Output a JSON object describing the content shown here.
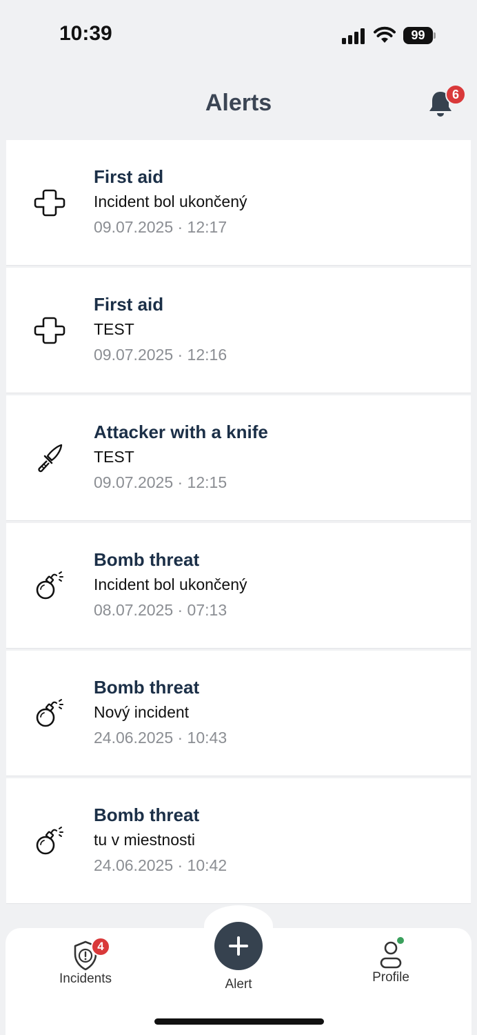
{
  "status_bar": {
    "time": "10:39",
    "battery": "99",
    "icons": [
      "signal-icon",
      "wifi-icon",
      "battery-icon"
    ]
  },
  "header": {
    "title": "Alerts",
    "notification_icon": "bell-icon",
    "notification_count": "6"
  },
  "alerts": [
    {
      "icon": "first-aid-cross-icon",
      "title": "First aid",
      "message": "Incident bol ukončený",
      "time": "09.07.2025 · 12:17"
    },
    {
      "icon": "first-aid-cross-icon",
      "title": "First aid",
      "message": "TEST",
      "time": "09.07.2025 · 12:16"
    },
    {
      "icon": "knife-icon",
      "title": "Attacker with a knife",
      "message": "TEST",
      "time": "09.07.2025 · 12:15"
    },
    {
      "icon": "bomb-icon",
      "title": "Bomb threat",
      "message": "Incident bol ukončený",
      "time": "08.07.2025 · 07:13"
    },
    {
      "icon": "bomb-icon",
      "title": "Bomb threat",
      "message": "Nový incident",
      "time": "24.06.2025 · 10:43"
    },
    {
      "icon": "bomb-icon",
      "title": "Bomb threat",
      "message": "tu v miestnosti",
      "time": "24.06.2025 · 10:42"
    }
  ],
  "tabbar": {
    "incidents": {
      "label": "Incidents",
      "icon": "shield-alert-icon",
      "badge": "4"
    },
    "alert": {
      "label": "Alert",
      "icon": "plus-icon"
    },
    "profile": {
      "label": "Profile",
      "icon": "person-icon",
      "status": "online"
    }
  },
  "colors": {
    "title": "#1b2f47",
    "badge": "#d9393a",
    "accent_button": "#36424f",
    "online": "#3aa05c",
    "timestamp": "#8b8e93"
  }
}
